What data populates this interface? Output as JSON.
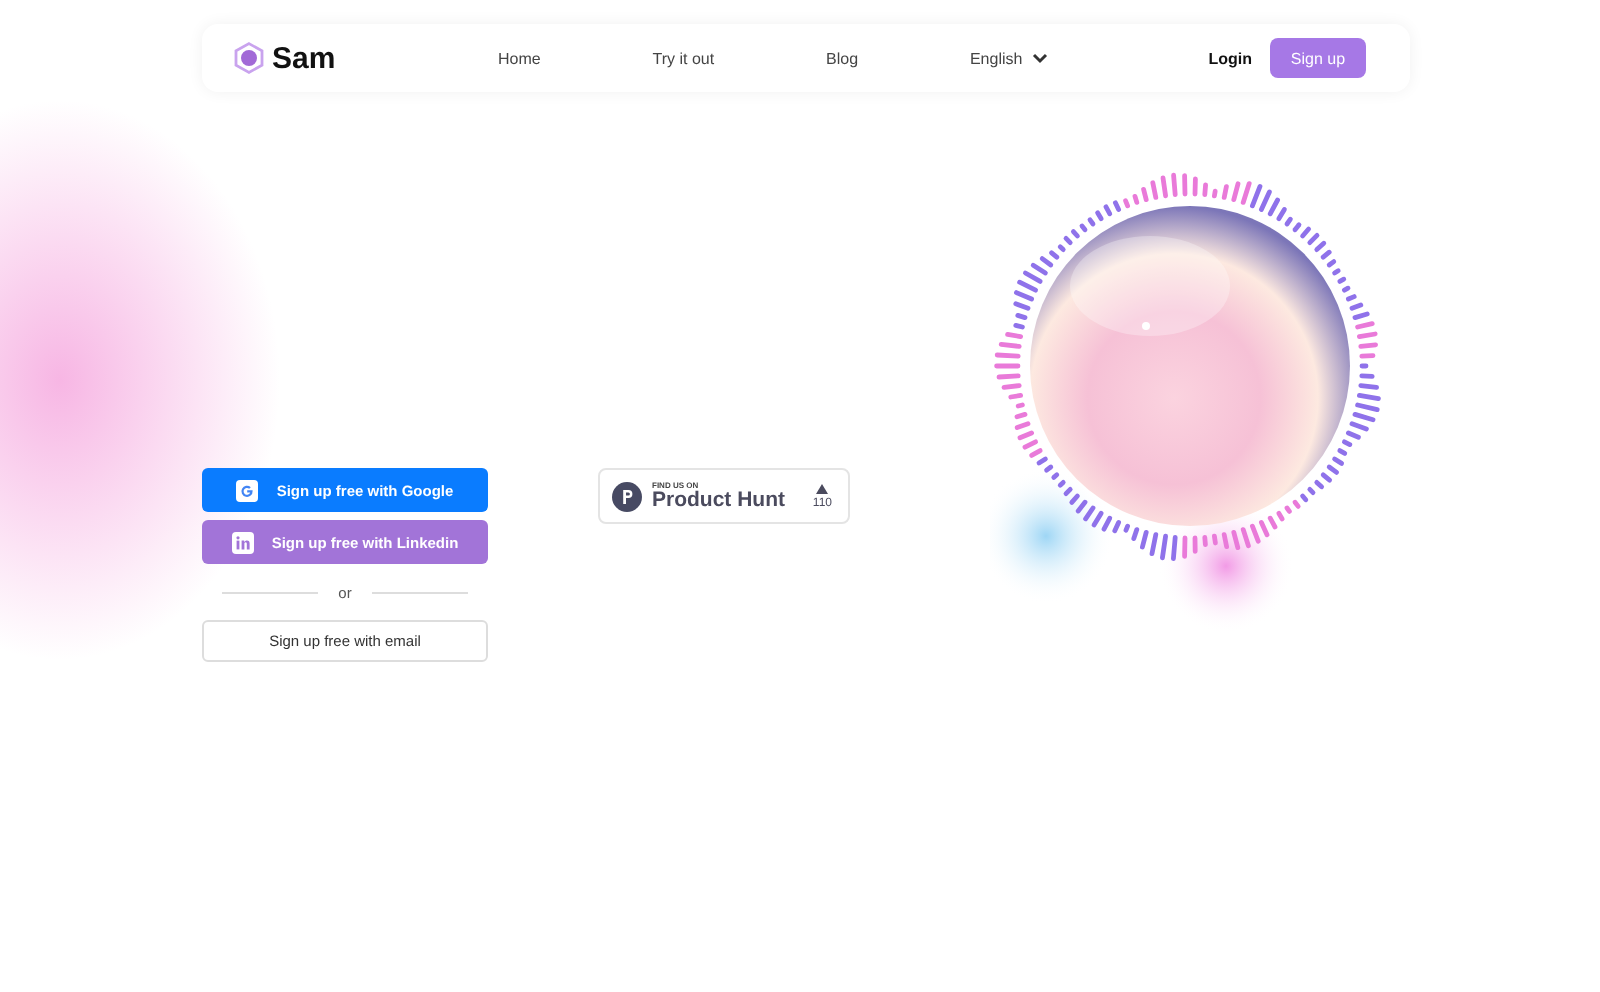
{
  "header": {
    "logo": "Sam",
    "nav": [
      {
        "label": "Home",
        "kind": "link"
      },
      {
        "label": "Try it out",
        "kind": "link"
      },
      {
        "label": "Blog",
        "kind": "link"
      },
      {
        "label": "English",
        "kind": "dropdown"
      }
    ],
    "login": "Login",
    "signup": "Sign up"
  },
  "signup": {
    "buttons": [
      {
        "label": "Sign up free with Google",
        "kind": "google"
      },
      {
        "label": "Sign up free with Linkedin",
        "kind": "linkedin"
      }
    ],
    "separator": "or",
    "email_button": "Sign up free with email"
  },
  "product_hunt": {
    "caption": "FIND US ON",
    "name": "Product Hunt",
    "count": "110"
  }
}
